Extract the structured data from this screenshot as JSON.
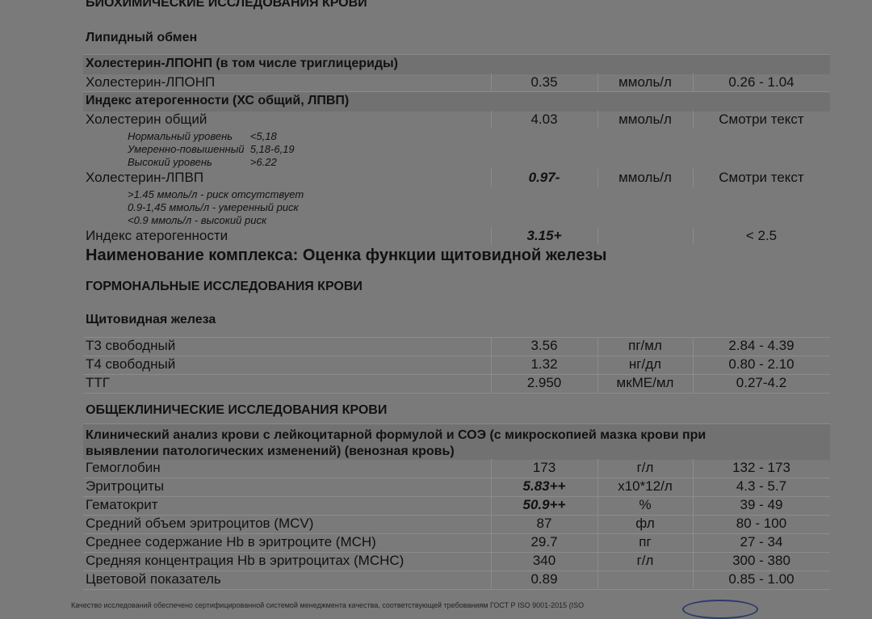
{
  "section_biochem": "БИОХИМИЧЕСКИЕ ИССЛЕДОВАНИЯ КРОВИ",
  "group_lipid": "Липидный обмен",
  "block_lponp_title": "Холестерин-ЛПОНП (в том числе триглицериды)",
  "row_lponp": {
    "name": "Холестерин-ЛПОНП",
    "value": "0.35",
    "unit": "ммоль/л",
    "ref": "0.26 - 1.04"
  },
  "block_athero_title": "Индекс атерогенности (ХС общий, ЛПВП)",
  "row_chol": {
    "name": "Холестерин общий",
    "value": "4.03",
    "unit": "ммоль/л",
    "ref": "Смотри текст"
  },
  "chol_notes": [
    "Нормальный уровень      <5,18",
    "Умеренно-повышенный  5,18-6,19",
    "Высокий уровень             >6.22"
  ],
  "row_hdl": {
    "name": "Холестерин-ЛПВП",
    "value": "0.97-",
    "unit": "ммоль/л",
    "ref": "Смотри текст"
  },
  "hdl_notes": [
    ">1.45 ммоль/л - риск отсутствует",
    "0.9-1,45 ммоль/л - умеренный риск",
    "<0.9 ммоль/л - высокий риск"
  ],
  "row_index": {
    "name": "Индекс атерогенности",
    "value": "3.15+",
    "unit": "",
    "ref": "< 2.5"
  },
  "complex_title": "Наименование комплекса: Оценка функции щитовидной железы",
  "section_hormone": "ГОРМОНАЛЬНЫЕ ИССЛЕДОВАНИЯ КРОВИ",
  "group_thyroid": "Щитовидная железа",
  "thyroid_rows": [
    {
      "name": "Т3 свободный",
      "value": "3.56",
      "unit": "пг/мл",
      "ref": "2.84 - 4.39"
    },
    {
      "name": "Т4 свободный",
      "value": "1.32",
      "unit": "нг/дл",
      "ref": "0.80 - 2.10"
    },
    {
      "name": "ТТГ",
      "value": "2.950",
      "unit": "мкМЕ/мл",
      "ref": "0.27-4.2"
    }
  ],
  "section_general": "ОБЩЕКЛИНИЧЕСКИЕ ИССЛЕДОВАНИЯ КРОВИ",
  "cbc_title_line1": "Клинический анализ крови с лейкоцитарной формулой и СОЭ (с микроскопией мазка крови при",
  "cbc_title_line2": "выявлении патологических изменений) (венозная кровь)",
  "cbc_rows": [
    {
      "name": "Гемоглобин",
      "value": "173",
      "unit": "г/л",
      "ref": "132 - 173"
    },
    {
      "name": "Эритроциты",
      "value": "5.83++",
      "unit": "x10*12/л",
      "ref": "4.3 - 5.7"
    },
    {
      "name": "Гематокрит",
      "value": "50.9++",
      "unit": "%",
      "ref": "39 - 49"
    },
    {
      "name": "Средний объем эритроцитов (MCV)",
      "value": "87",
      "unit": "фл",
      "ref": "80 - 100"
    },
    {
      "name": "Среднее содержание Hb в эритроците (MCH)",
      "value": "29.7",
      "unit": "пг",
      "ref": "27 - 34"
    },
    {
      "name": "Средняя концентрация Hb в эритроцитах (MCHC)",
      "value": "340",
      "unit": "г/л",
      "ref": "300 - 380"
    },
    {
      "name": "Цветовой показатель",
      "value": "0.89",
      "unit": "",
      "ref": "0.85 - 1.00"
    }
  ],
  "footer": "Качество исследований обеспечено сертифицированной системой менеджмента качества, соответствующей требованиям ГОСТ Р ISO 9001-2015 (ISO"
}
